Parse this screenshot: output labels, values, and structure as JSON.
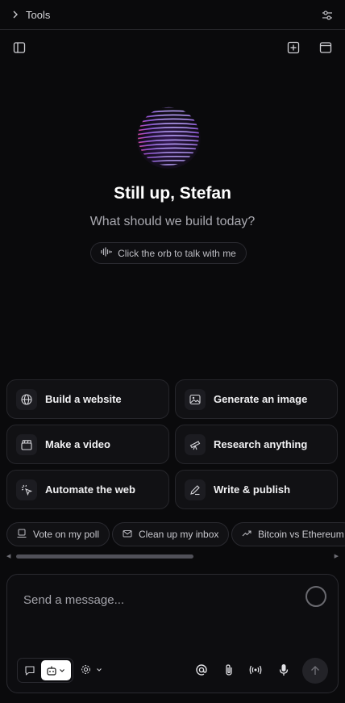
{
  "topbar": {
    "title": "Tools",
    "chevron_icon": "chevron-right-icon",
    "settings_icon": "sliders-icon"
  },
  "toolbar": {
    "sidebar_icon": "sidebar-toggle-icon",
    "new_chat_icon": "plus-square-icon",
    "window_icon": "browser-window-icon"
  },
  "hero": {
    "orb_icon": "voice-orb",
    "greeting": "Still up, Stefan",
    "subtitle": "What should we build today?",
    "hint": "Click the orb to talk with me",
    "hint_icon": "waveform-icon"
  },
  "actions": [
    {
      "label": "Build a website",
      "icon": "globe-icon"
    },
    {
      "label": "Generate an image",
      "icon": "image-icon"
    },
    {
      "label": "Make a video",
      "icon": "clapperboard-icon"
    },
    {
      "label": "Research anything",
      "icon": "telescope-icon"
    },
    {
      "label": "Automate the web",
      "icon": "cursor-click-icon"
    },
    {
      "label": "Write & publish",
      "icon": "pen-icon"
    }
  ],
  "suggestions": [
    {
      "label": "Vote on my poll",
      "icon": "ballot-icon"
    },
    {
      "label": "Clean up my inbox",
      "icon": "mail-icon"
    },
    {
      "label": "Bitcoin vs Ethereum",
      "icon": "trending-icon"
    }
  ],
  "composer": {
    "placeholder": "Send a message...",
    "mode_chat_icon": "chat-bubble-icon",
    "mode_agent_icon": "robot-icon",
    "settings_icon": "gear-icon",
    "mention_icon": "at-icon",
    "attach_icon": "paperclip-icon",
    "live_icon": "broadcast-icon",
    "mic_icon": "microphone-icon",
    "send_icon": "arrow-up-icon"
  },
  "colors": {
    "background": "#0a0a0c",
    "card": "#111114",
    "border": "#26262b",
    "orb_purple": "#8a4fd8",
    "orb_pink": "#e0468f"
  }
}
